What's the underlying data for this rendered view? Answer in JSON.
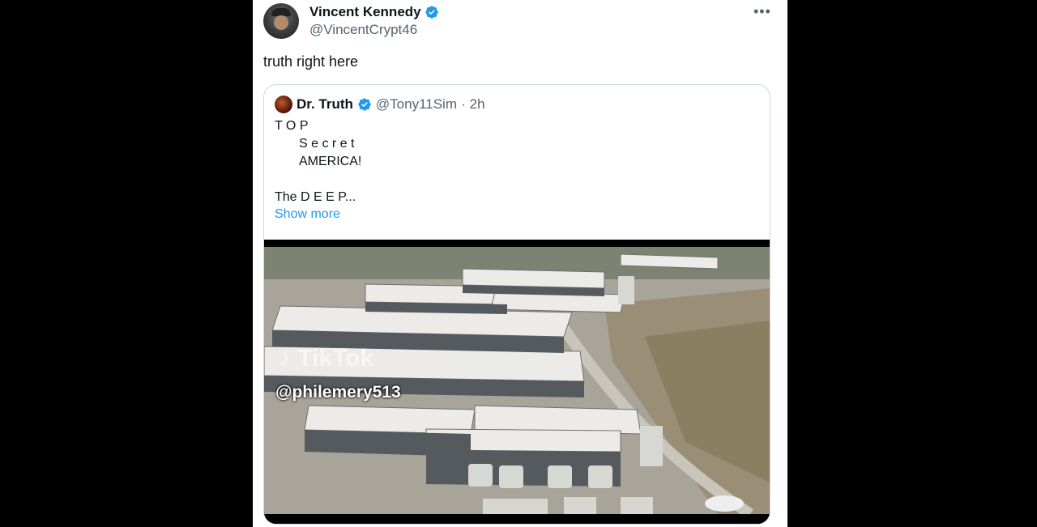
{
  "author": {
    "name": "Vincent Kennedy",
    "handle": "@VincentCrypt46",
    "verified_icon": "verified-badge-icon"
  },
  "more_icon": "more-options-icon",
  "tweet": {
    "text": "truth right here"
  },
  "quoted": {
    "name": "Dr. Truth",
    "handle": "@Tony11Sim",
    "separator": "·",
    "time": "2h",
    "lines": [
      "T O P",
      "S e c r e t",
      "AMERICA!",
      "The D E E P..."
    ],
    "show_more": "Show more",
    "media": {
      "watermark_brand": "TikTok",
      "watermark_handle": "@philemery513"
    }
  },
  "colors": {
    "link": "#1d9bf0",
    "verified": "#1d9bf0",
    "secondary_text": "#536471",
    "border": "#cfd9de"
  }
}
